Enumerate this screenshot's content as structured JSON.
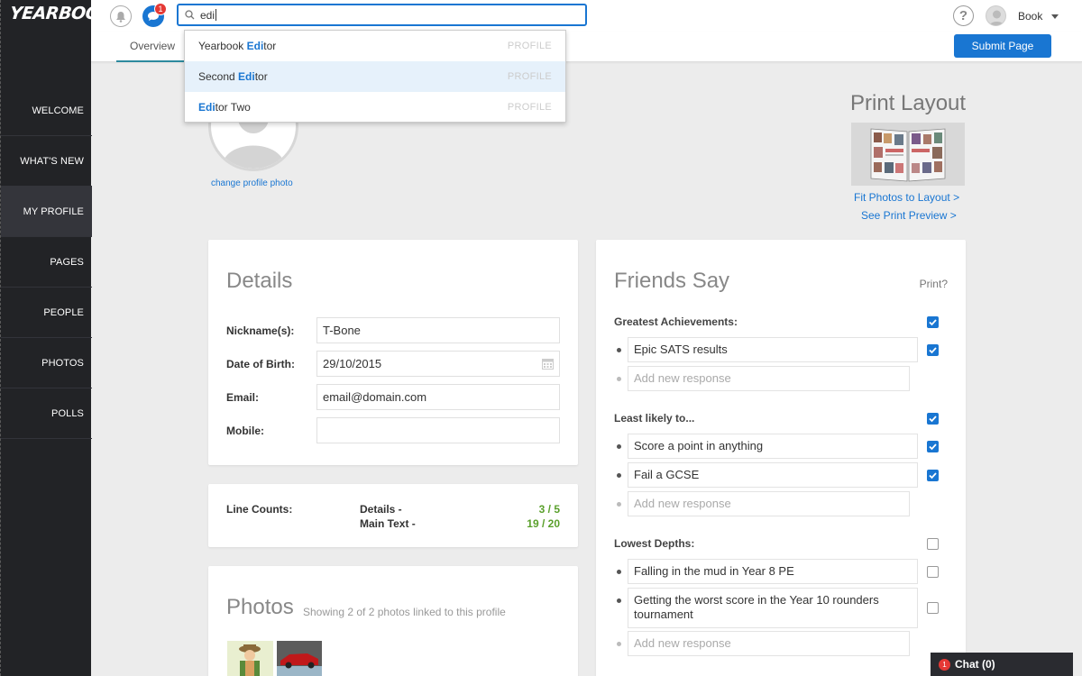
{
  "app": {
    "logo": "YEARBOOK"
  },
  "sidebar": {
    "items": [
      {
        "label": "WELCOME"
      },
      {
        "label": "WHAT'S NEW"
      },
      {
        "label": "MY PROFILE",
        "active": true
      },
      {
        "label": "PAGES"
      },
      {
        "label": "PEOPLE"
      },
      {
        "label": "PHOTOS"
      },
      {
        "label": "POLLS"
      }
    ]
  },
  "topbar": {
    "notification_count": "1",
    "search_value": "edi",
    "help_label": "?",
    "user_name": "Book"
  },
  "subbar": {
    "tab_label": "Overview",
    "submit_label": "Submit Page"
  },
  "search_results": [
    {
      "before": "Yearbook ",
      "match": "Edi",
      "after": "tor",
      "type": "PROFILE"
    },
    {
      "before": "Second ",
      "match": "Edi",
      "after": "tor",
      "type": "PROFILE",
      "highlighted": true
    },
    {
      "before": "",
      "match": "Edi",
      "after": "tor Two",
      "type": "PROFILE"
    }
  ],
  "profile": {
    "change_photo": "change profile photo"
  },
  "print_layout": {
    "title": "Print Layout",
    "fit_link": "Fit Photos to Layout >",
    "preview_link": "See Print Preview >"
  },
  "details": {
    "title": "Details",
    "fields": [
      {
        "label": "Nickname(s):",
        "value": "T-Bone"
      },
      {
        "label": "Date of Birth:",
        "value": "29/10/2015"
      },
      {
        "label": "Email:",
        "value": "email@domain.com"
      },
      {
        "label": "Mobile:",
        "value": ""
      }
    ]
  },
  "line_counts": {
    "label": "Line Counts:",
    "rows": [
      {
        "name": "Details -",
        "value": "3 / 5"
      },
      {
        "name": "Main Text -",
        "value": "19 / 20"
      }
    ]
  },
  "photos": {
    "title": "Photos",
    "subtitle": "Showing 2 of 2 photos linked to this profile"
  },
  "friends": {
    "title": "Friends Say",
    "print_label": "Print?",
    "add_placeholder": "Add new response",
    "sections": [
      {
        "question": "Greatest Achievements:",
        "checked": true,
        "responses": [
          {
            "text": "Epic SATS results",
            "checked": true
          }
        ]
      },
      {
        "question": "Least likely to...",
        "checked": true,
        "responses": [
          {
            "text": "Score a point in anything",
            "checked": true
          },
          {
            "text": "Fail a GCSE",
            "checked": true
          }
        ]
      },
      {
        "question": "Lowest Depths:",
        "checked": false,
        "responses": [
          {
            "text": "Falling in the mud in Year 8 PE",
            "checked": false
          },
          {
            "text": "Getting the worst score in the Year 10 rounders tournament",
            "checked": false
          }
        ]
      }
    ]
  },
  "chat": {
    "label": "Chat (0)",
    "badge": "1"
  },
  "colors": {
    "accent": "#1976d2",
    "sidebar": "#222326",
    "success": "#5aa02c",
    "badge": "#e53935"
  }
}
